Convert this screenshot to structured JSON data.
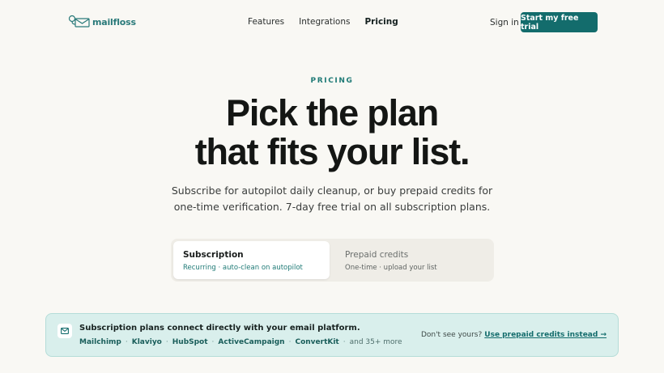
{
  "nav": {
    "logo_text": "mailfloss",
    "links": [
      {
        "label": "Features"
      },
      {
        "label": "Integrations"
      },
      {
        "label": "Pricing"
      }
    ],
    "signin_label": "Sign in",
    "cta_label": "Start my free trial"
  },
  "hero": {
    "eyebrow": "PRICING",
    "headline_line1": "Pick the plan",
    "headline_line2": "that fits your list.",
    "subtext": "Subscribe for autopilot daily cleanup, or buy prepaid credits for one-time verification. 7-day free trial on all subscription plans."
  },
  "plan_toggle": {
    "options": [
      {
        "title": "Subscription",
        "subtitle": "Recurring · auto-clean on autopilot",
        "selected": true
      },
      {
        "title": "Prepaid credits",
        "subtitle": "One-time · upload your list",
        "selected": false
      }
    ]
  },
  "integrations_banner": {
    "icon": "mail-icon",
    "title": "Subscription plans connect directly with your email platform.",
    "platforms": [
      "Mailchimp",
      "Klaviyo",
      "HubSpot",
      "ActiveCampaign",
      "ConvertKit"
    ],
    "separator": "·",
    "more_text": "and 35+ more",
    "question": "Don't see yours?",
    "link_label": "Use prepaid credits instead →"
  },
  "colors": {
    "brand": "#136c6c",
    "background": "#f9f8f4",
    "banner_bg": "#d9efec"
  }
}
